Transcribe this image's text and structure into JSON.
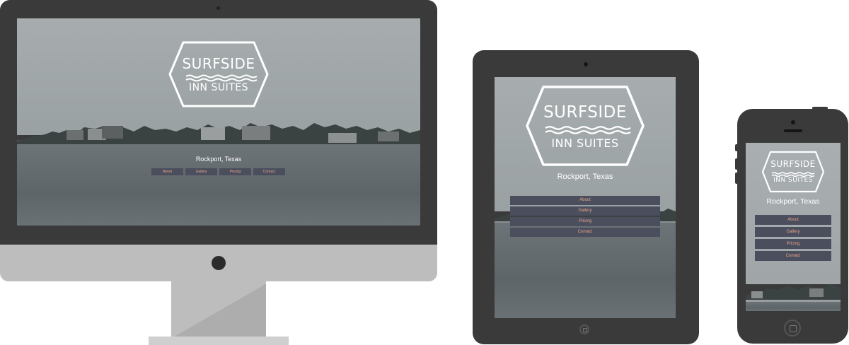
{
  "brand": {
    "line1": "SURFSIDE",
    "line2": "INN SUITES"
  },
  "location": "Rockport, Texas",
  "nav": [
    {
      "label": "About"
    },
    {
      "label": "Gallery"
    },
    {
      "label": "Pricing"
    },
    {
      "label": "Contact"
    }
  ],
  "colors": {
    "device_frame": "#3a3a3a",
    "nav_button_bg": "#4b4e5d",
    "nav_button_text": "#e8a48c"
  },
  "devices": [
    "desktop",
    "tablet",
    "phone"
  ]
}
